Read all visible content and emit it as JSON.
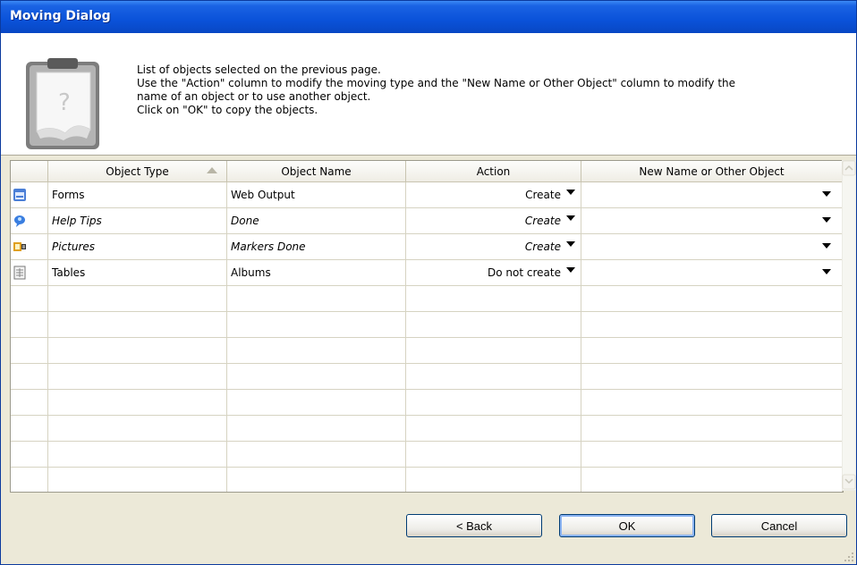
{
  "window": {
    "title": "Moving Dialog"
  },
  "header": {
    "lines": [
      "List of objects selected on the previous page.",
      "Use the \"Action\" column to modify the moving type and the \"New Name or Other Object\" column to modify the",
      "name of an object or to use another object.",
      "Click on \"OK\" to copy the objects."
    ],
    "icon": "clipboard-help-icon"
  },
  "table": {
    "columns": [
      "Object Type",
      "Object Name",
      "Action",
      "New Name or Other Object"
    ],
    "sort_column": "Object Type",
    "rows": [
      {
        "icon": "form-icon",
        "type": "Forms",
        "name": "Web Output",
        "action": "Create",
        "new_name": "",
        "italic": false
      },
      {
        "icon": "help-tip-icon",
        "type": "Help Tips",
        "name": "Done",
        "action": "Create",
        "new_name": "",
        "italic": true
      },
      {
        "icon": "pictures-icon",
        "type": "Pictures",
        "name": "Markers Done",
        "action": "Create",
        "new_name": "",
        "italic": true
      },
      {
        "icon": "table-icon",
        "type": "Tables",
        "name": "Albums",
        "action": "Do not create",
        "new_name": "",
        "italic": false
      }
    ]
  },
  "buttons": {
    "back": "< Back",
    "ok": "OK",
    "cancel": "Cancel"
  }
}
